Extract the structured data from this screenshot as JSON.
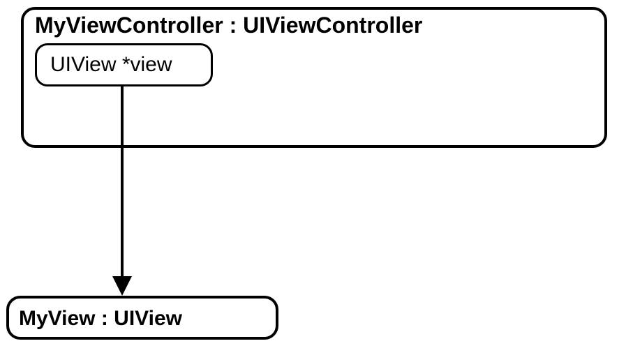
{
  "diagram": {
    "controller_box": {
      "title": "MyViewController : UIViewController",
      "property": "UIView *view"
    },
    "target_box": {
      "title": "MyView : UIView"
    }
  }
}
